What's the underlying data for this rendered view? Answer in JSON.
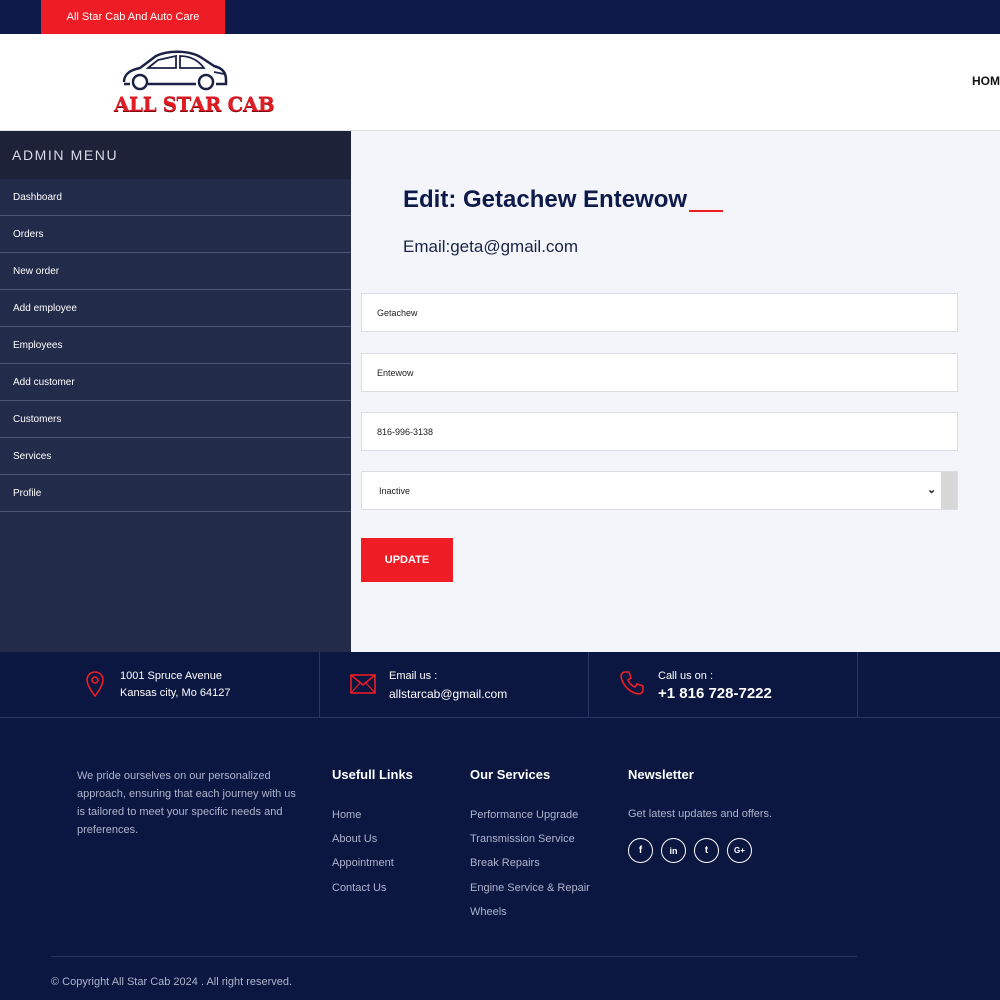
{
  "topbar": {
    "tag_text": "All Star Cab And Auto Care"
  },
  "header": {
    "logo_text": "ALL STAR CAB",
    "nav_home": "HOME"
  },
  "sidebar": {
    "title": "ADMIN MENU",
    "items": [
      {
        "label": "Dashboard"
      },
      {
        "label": "Orders"
      },
      {
        "label": "New order"
      },
      {
        "label": "Add employee"
      },
      {
        "label": "Employees"
      },
      {
        "label": "Add customer"
      },
      {
        "label": "Customers"
      },
      {
        "label": "Services"
      },
      {
        "label": "Profile"
      }
    ]
  },
  "main": {
    "title": "Edit: Getachew Entewow",
    "email": "Email:geta@gmail.com",
    "first_name": "Getachew",
    "last_name": "Entewow",
    "phone": "816-996-3138",
    "status_selected": "Inactive",
    "update_label": "UPDATE"
  },
  "contact": {
    "address_line1": "1001 Spruce Avenue",
    "address_line2": "Kansas city, Mo 64127",
    "email_label": "Email us :",
    "email_value": "allstarcab@gmail.com",
    "call_label": "Call us on :",
    "call_value": "+1 816 728-7222"
  },
  "footer": {
    "about": "We pride ourselves on our personalized approach, ensuring that each journey with us is tailored to meet your specific needs and preferences.",
    "links_title": "Usefull Links",
    "links": [
      "Home",
      "About Us",
      "Appointment",
      "Contact Us"
    ],
    "services_title": "Our Services",
    "services": [
      "Performance Upgrade",
      "Transmission Service",
      "Break Repairs",
      "Engine Service & Repair",
      "Wheels"
    ],
    "newsletter_title": "Newsletter",
    "newsletter_text": "Get latest updates and offers.",
    "social": [
      {
        "icon": "facebook-icon",
        "glyph": "f"
      },
      {
        "icon": "linkedin-icon",
        "glyph": "in"
      },
      {
        "icon": "twitter-icon",
        "glyph": "t"
      },
      {
        "icon": "google-plus-icon",
        "glyph": "G+"
      }
    ],
    "copyright": "© Copyright All Star Cab 2024 . All right reserved."
  },
  "colors": {
    "accent": "#ee1c24",
    "navy": "#0b1641",
    "sidebar": "#222b4a",
    "main_bg": "#f4f5fa"
  }
}
